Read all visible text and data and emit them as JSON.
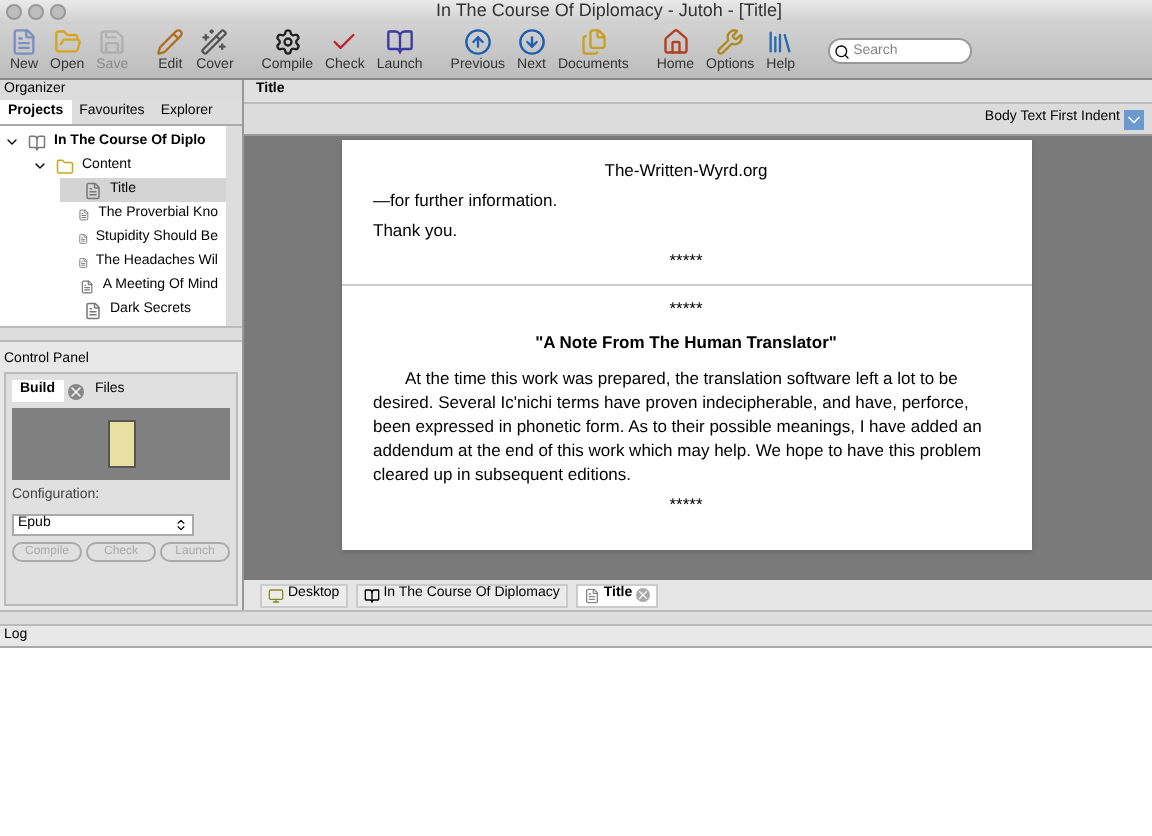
{
  "window": {
    "title": "In The Course Of Diplomacy - Jutoh - [Title]"
  },
  "toolbar": {
    "buttons": [
      {
        "label": "New",
        "disabled": false
      },
      {
        "label": "Open",
        "disabled": false
      },
      {
        "label": "Save",
        "disabled": true
      },
      {
        "label": "Edit",
        "disabled": false
      },
      {
        "label": "Cover",
        "disabled": false
      },
      {
        "label": "Compile",
        "disabled": false
      },
      {
        "label": "Check",
        "disabled": false
      },
      {
        "label": "Launch",
        "disabled": false
      },
      {
        "label": "Previous",
        "disabled": false
      },
      {
        "label": "Next",
        "disabled": false
      },
      {
        "label": "Documents",
        "disabled": false
      },
      {
        "label": "Home",
        "disabled": false
      },
      {
        "label": "Options",
        "disabled": false
      },
      {
        "label": "Help",
        "disabled": false
      }
    ],
    "search": {
      "placeholder": "Search"
    }
  },
  "organizer": {
    "title": "Organizer",
    "tabs": [
      {
        "label": "Projects",
        "selected": true
      },
      {
        "label": "Favourites",
        "selected": false
      },
      {
        "label": "Explorer",
        "selected": false
      }
    ],
    "tree": [
      {
        "label": "In The Course Of Diplo",
        "kind": "project",
        "expanded": true,
        "selected": false,
        "children": [
          {
            "label": "Content",
            "kind": "folder",
            "expanded": true,
            "selected": false,
            "children": [
              {
                "label": "Title",
                "kind": "document",
                "selected": true
              },
              {
                "label": "The Proverbial Kno",
                "kind": "document",
                "selected": false
              },
              {
                "label": "Stupidity Should Be",
                "kind": "document",
                "selected": false
              },
              {
                "label": "The Headaches Wil",
                "kind": "document",
                "selected": false
              },
              {
                "label": "A Meeting Of Mind",
                "kind": "document",
                "selected": false
              },
              {
                "label": "Dark Secrets",
                "kind": "document",
                "selected": false
              }
            ]
          }
        ]
      }
    ]
  },
  "control_panel": {
    "title": "Control Panel",
    "tabs": [
      {
        "label": "Build",
        "selected": true
      },
      {
        "label": "Files",
        "selected": false
      }
    ],
    "configuration_label": "Configuration:",
    "configuration": "Epub",
    "buttons": [
      {
        "label": "Compile",
        "disabled": true
      },
      {
        "label": "Check",
        "disabled": true
      },
      {
        "label": "Launch",
        "disabled": true
      }
    ]
  },
  "editor": {
    "title": "Title",
    "paragraph_style": "Body Text First Indent",
    "document": [
      {
        "kind": "center",
        "text": "The-Written-Wyrd.org"
      },
      {
        "kind": "para",
        "text": "—for further information."
      },
      {
        "kind": "para",
        "text": "Thank you."
      },
      {
        "kind": "center",
        "text": "*****"
      },
      {
        "kind": "break"
      },
      {
        "kind": "center",
        "text": "*****"
      },
      {
        "kind": "heading",
        "text": "\"A Note From The Human Translator\""
      },
      {
        "kind": "indent",
        "text": "At the time this work was prepared, the translation software left a lot to be desired.  Several Ic'nichi terms have proven indecipherable, and have, perforce, been expressed in phonetic form.  As to their possible meanings, I have added an addendum at the end of this work which may help.  We hope to have this problem cleared up in subsequent editions."
      },
      {
        "kind": "center",
        "text": "*****"
      }
    ],
    "tabs": [
      {
        "label": "Desktop",
        "kind": "desktop",
        "selected": false,
        "closable": false
      },
      {
        "label": "In The Course Of Diplomacy",
        "kind": "project",
        "selected": false,
        "closable": false
      },
      {
        "label": "Title",
        "kind": "document",
        "selected": true,
        "closable": true
      }
    ]
  },
  "log": {
    "title": "Log"
  }
}
